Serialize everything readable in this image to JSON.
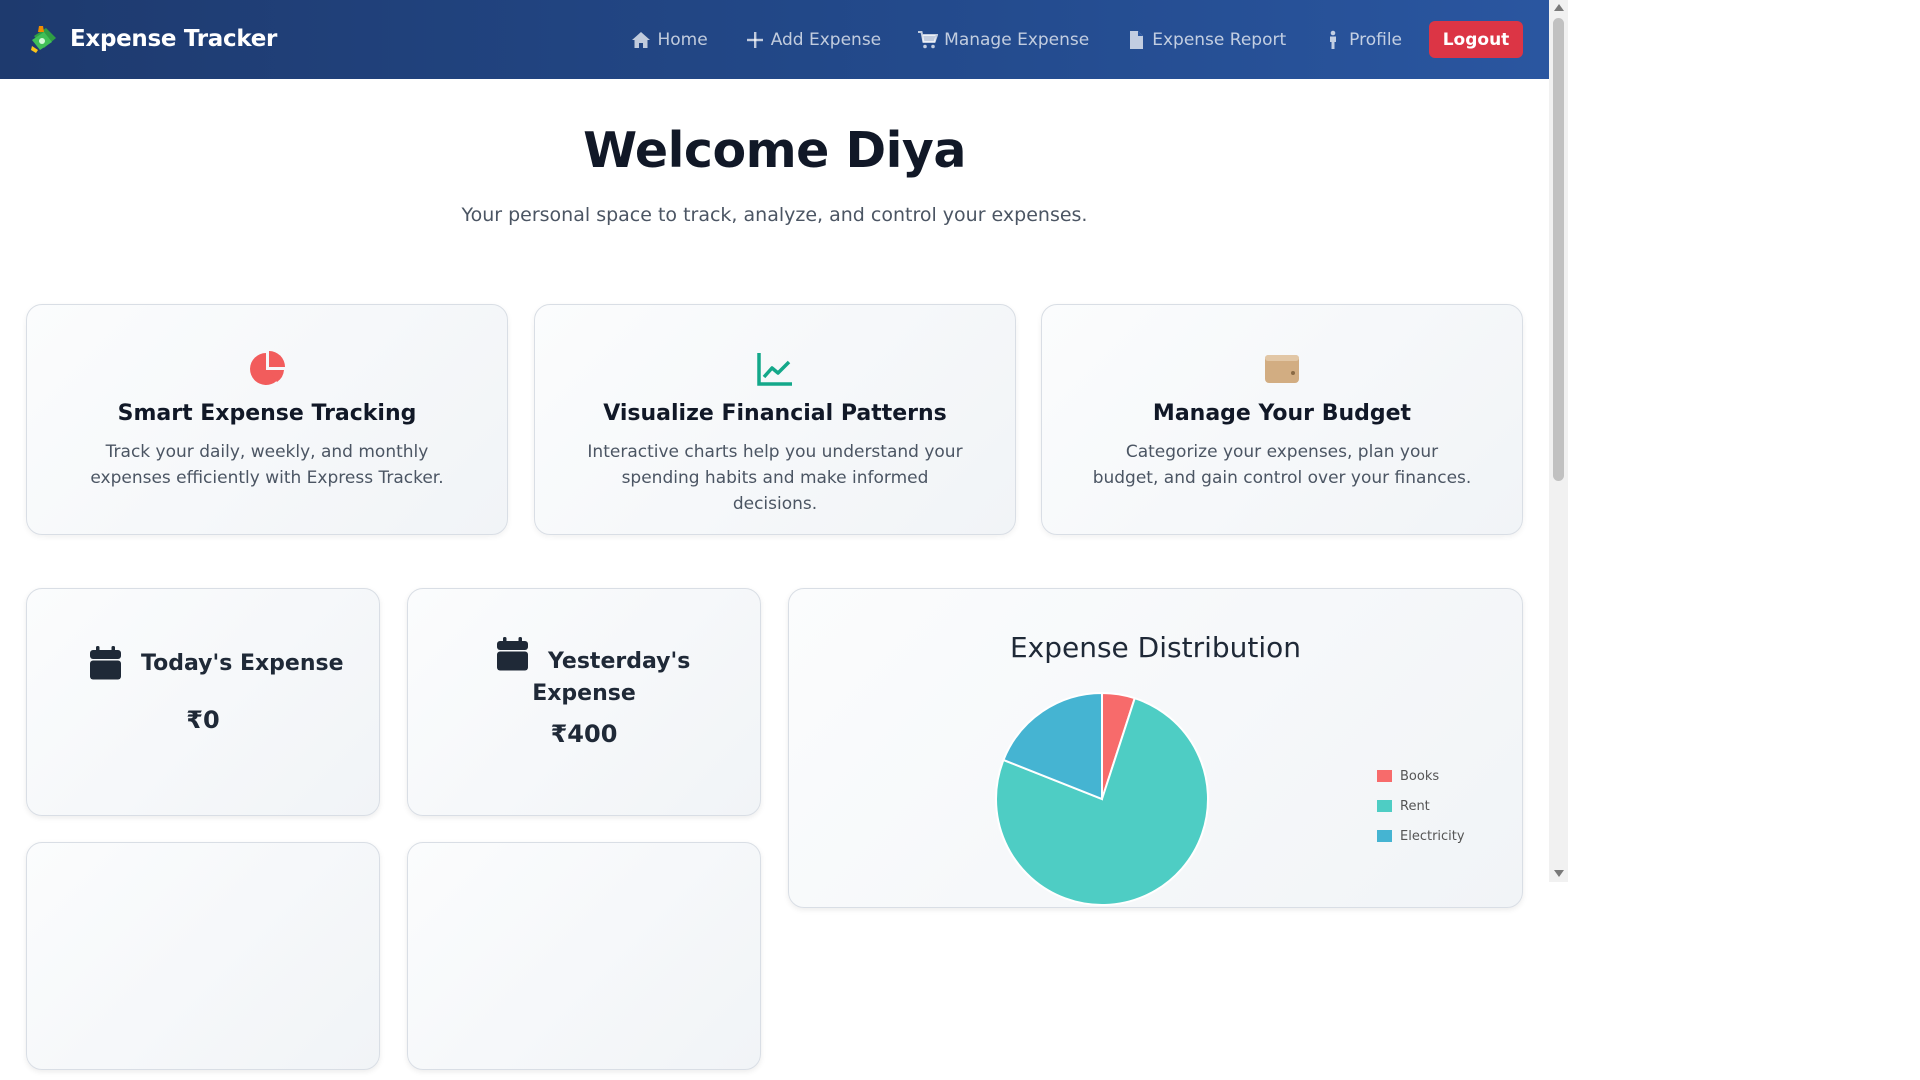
{
  "app": {
    "brand": "Expense Tracker"
  },
  "nav": {
    "items": [
      {
        "label": "Home",
        "icon": "home-icon"
      },
      {
        "label": "Add Expense",
        "icon": "plus-icon"
      },
      {
        "label": "Manage Expense",
        "icon": "cart-icon"
      },
      {
        "label": "Expense Report",
        "icon": "file-icon"
      },
      {
        "label": "Profile",
        "icon": "person-icon"
      }
    ],
    "logout_label": "Logout"
  },
  "hero": {
    "title": "Welcome Diya",
    "subtitle": "Your personal space to track, analyze, and control your expenses."
  },
  "features": [
    {
      "icon": "pie-chart-icon",
      "color": "#f25c5c",
      "title": "Smart Expense Tracking",
      "description": "Track your daily, weekly, and monthly expenses efficiently with Express Tracker."
    },
    {
      "icon": "line-chart-icon",
      "color": "#14a88a",
      "title": "Visualize Financial Patterns",
      "description": "Interactive charts help you understand your spending habits and make informed decisions."
    },
    {
      "icon": "wallet-icon",
      "color": "#cfa77a",
      "title": "Manage Your Budget",
      "description": "Categorize your expenses, plan your budget, and gain control over your finances."
    }
  ],
  "stats": {
    "today": {
      "title": "Today's Expense",
      "value": "₹0"
    },
    "yesterday": {
      "title_line1": "Yesterday's",
      "title_line2": "Expense",
      "value": "₹400"
    }
  },
  "colors": {
    "nav_bg": "#1e3a6e",
    "logout": "#dc3545"
  },
  "chart_data": {
    "type": "pie",
    "title": "Expense Distribution",
    "categories": [
      "Books",
      "Rent",
      "Electricity"
    ],
    "values": [
      5,
      76,
      19
    ],
    "colors": [
      "#f76b6b",
      "#4ecdc4",
      "#45b4d2"
    ],
    "legend": "right"
  }
}
